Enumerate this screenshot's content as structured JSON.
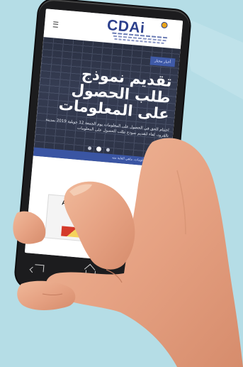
{
  "screen": {
    "logo": {
      "text": "CDAi"
    },
    "hero": {
      "tag": "أخبار مختار",
      "title": "تقديم نموذج طلب الحصول على المعلومات",
      "description": "اختتام الحق في الحصول على المعلومات يوم الجمعة 12 جويلية 2019 بمدينة تالقرود، لقاء لتقديم نموذج طلب الحصول على المعلومات",
      "strip_text": "الحصول على المعلومات، ماهي الغاية منه"
    },
    "card": {
      "label": "Ac"
    }
  },
  "colors": {
    "background": "#b5dde6",
    "brand_blue": "#2b3f8c",
    "hero_dark": "#2d3346",
    "skin": "#e8a989"
  }
}
